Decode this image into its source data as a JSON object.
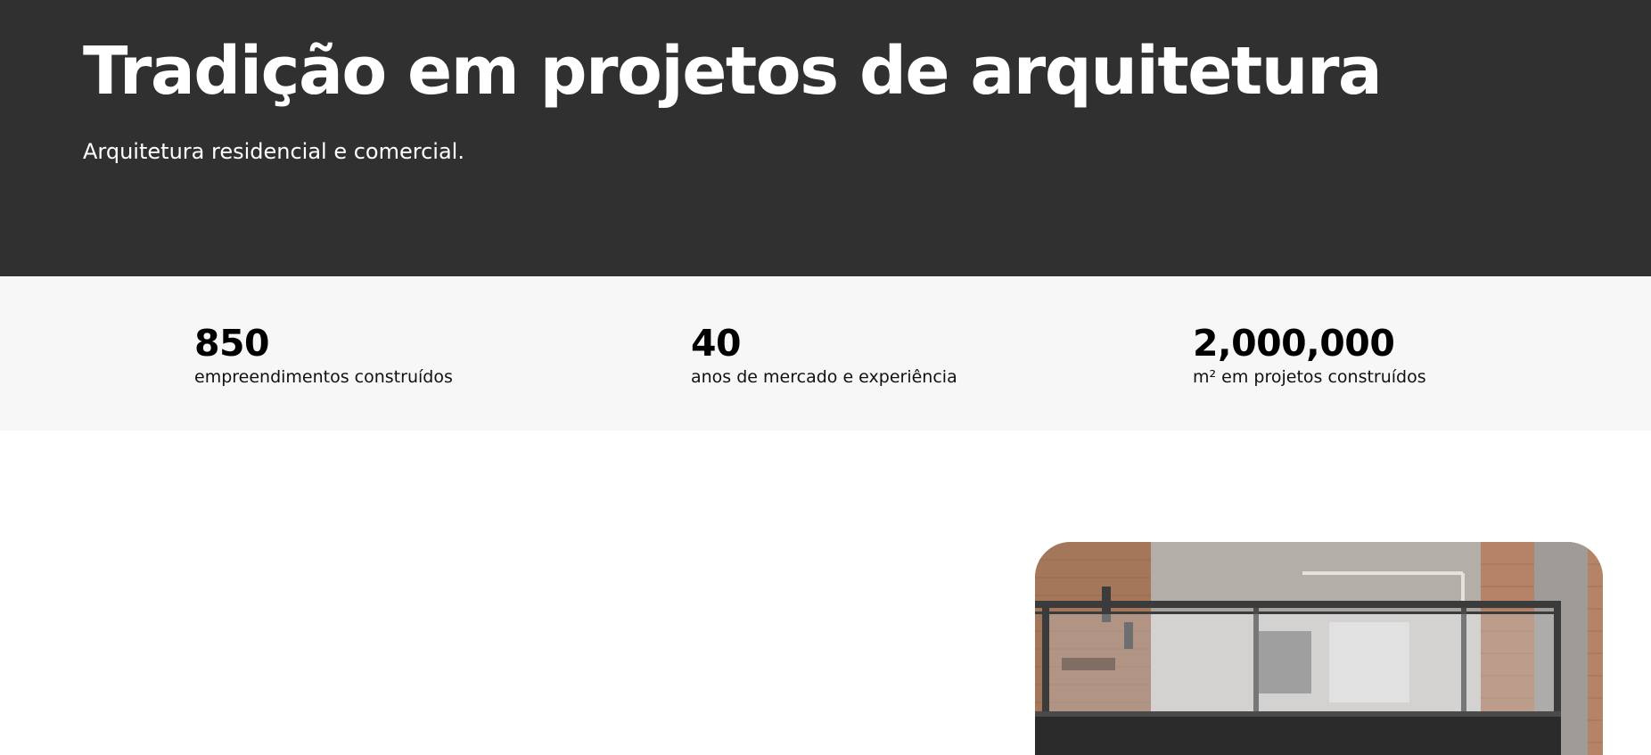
{
  "hero": {
    "title": "Tradição em projetos de arquitetura",
    "subtitle": "Arquitetura residencial e comercial."
  },
  "stats": [
    {
      "value": "850",
      "label": "empreendimentos construídos"
    },
    {
      "value": "40",
      "label": "anos de mercado e experiência"
    },
    {
      "value": "2,000,000",
      "label": "m² em projetos construídos"
    }
  ],
  "colors": {
    "hero_background": "#303030",
    "stats_background": "#f7f7f7",
    "text_on_dark": "#ffffff",
    "text_on_light": "#000000"
  },
  "images": {
    "project_photo": "photo-of-loft-interior-with-mezzanine-railing"
  }
}
